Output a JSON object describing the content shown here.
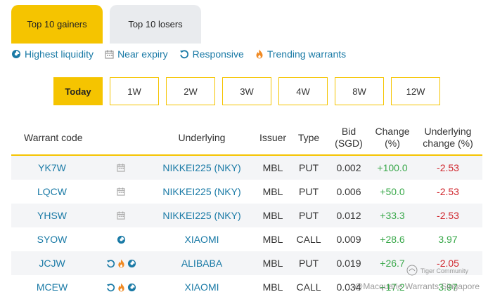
{
  "tabs": [
    {
      "label": "Top 10 gainers",
      "active": true
    },
    {
      "label": "Top 10 losers",
      "active": false
    }
  ],
  "filters": [
    {
      "label": "Highest liquidity",
      "icon": "liquidity-icon"
    },
    {
      "label": "Near expiry",
      "icon": "calendar-icon"
    },
    {
      "label": "Responsive",
      "icon": "refresh-icon"
    },
    {
      "label": "Trending warrants",
      "icon": "flame-icon"
    }
  ],
  "periods": [
    "Today",
    "1W",
    "2W",
    "3W",
    "4W",
    "8W",
    "12W"
  ],
  "active_period": "Today",
  "table": {
    "headers": {
      "code": "Warrant code",
      "underlying": "Underlying",
      "issuer": "Issuer",
      "type": "Type",
      "bid_line1": "Bid",
      "bid_line2": "(SGD)",
      "change_line1": "Change",
      "change_line2": "(%)",
      "uchg_line1": "Underlying",
      "uchg_line2": "change (%)"
    },
    "rows": [
      {
        "code": "YK7W",
        "icons": [
          "calendar-icon"
        ],
        "underlying": "NIKKEI225 (NKY)",
        "issuer": "MBL",
        "type": "PUT",
        "bid": "0.002",
        "change": "+100.0",
        "uchg": "-2.53"
      },
      {
        "code": "LQCW",
        "icons": [
          "calendar-icon"
        ],
        "underlying": "NIKKEI225 (NKY)",
        "issuer": "MBL",
        "type": "PUT",
        "bid": "0.006",
        "change": "+50.0",
        "uchg": "-2.53"
      },
      {
        "code": "YHSW",
        "icons": [
          "calendar-icon"
        ],
        "underlying": "NIKKEI225 (NKY)",
        "issuer": "MBL",
        "type": "PUT",
        "bid": "0.012",
        "change": "+33.3",
        "uchg": "-2.53"
      },
      {
        "code": "SYOW",
        "icons": [
          "liquidity-icon"
        ],
        "underlying": "XIAOMI",
        "issuer": "MBL",
        "type": "CALL",
        "bid": "0.009",
        "change": "+28.6",
        "uchg": "3.97"
      },
      {
        "code": "JCJW",
        "icons": [
          "refresh-icon",
          "flame-icon",
          "liquidity-icon"
        ],
        "underlying": "ALIBABA",
        "issuer": "MBL",
        "type": "PUT",
        "bid": "0.019",
        "change": "+26.7",
        "uchg": "-2.05"
      },
      {
        "code": "MCEW",
        "icons": [
          "refresh-icon",
          "flame-icon",
          "liquidity-icon"
        ],
        "underlying": "XIAOMI",
        "issuer": "MBL",
        "type": "CALL",
        "bid": "0.034",
        "change": "+17.2",
        "uchg": "3.97"
      }
    ]
  },
  "watermark": {
    "brand": "Tiger Community",
    "text": "@Macquarie Warrants Singapore"
  },
  "colors": {
    "accent": "#f5c400",
    "link": "#1a7aa6",
    "positive": "#39a84a",
    "negative": "#d0262d",
    "flame": "#f08a24"
  }
}
